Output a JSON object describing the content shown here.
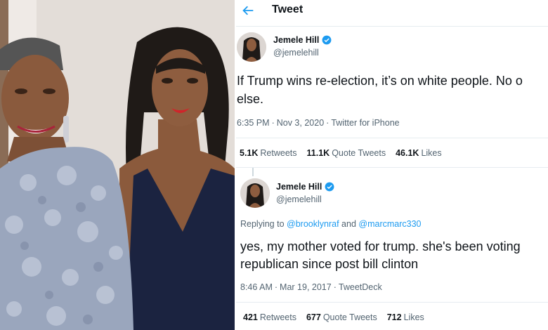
{
  "header": {
    "title": "Tweet"
  },
  "colors": {
    "accent": "#1d9bf0",
    "muted": "#536471",
    "text": "#0f1419"
  },
  "photo": {
    "description_icon": "two-women-photo"
  },
  "tweet1": {
    "name": "Jemele Hill",
    "handle": "@jemelehill",
    "text_line1": "If Trump wins re-election, it’s on white people. No o",
    "text_line2": "else.",
    "time": "6:35 PM",
    "date": "Nov 3, 2020",
    "source": "Twitter for iPhone",
    "retweets": "5.1K",
    "retweets_label": "Retweets",
    "quotes": "11.1K",
    "quotes_label": "Quote Tweets",
    "likes": "46.1K",
    "likes_label": "Likes"
  },
  "tweet2": {
    "name": "Jemele Hill",
    "handle": "@jemelehill",
    "replying_prefix": "Replying to",
    "mention1": "@brooklynraf",
    "and": "and",
    "mention2": "@marcmarc330",
    "text_line1": "yes, my mother voted for trump. she's been voting",
    "text_line2": "republican since post bill clinton",
    "time": "8:46 AM",
    "date": "Mar 19, 2017",
    "source": "TweetDeck",
    "retweets": "421",
    "retweets_label": "Retweets",
    "quotes": "677",
    "quotes_label": "Quote Tweets",
    "likes": "712",
    "likes_label": "Likes"
  }
}
